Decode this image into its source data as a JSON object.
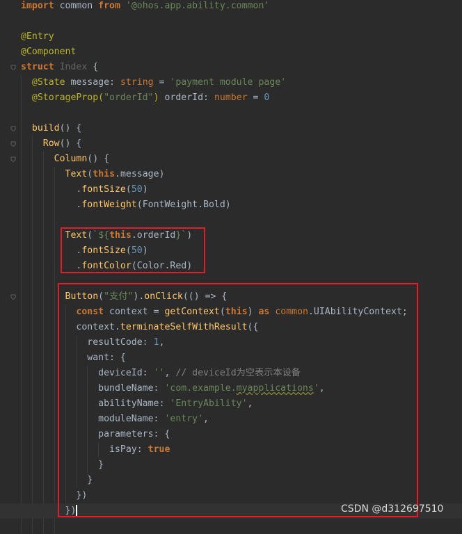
{
  "editor": {
    "lines": [
      {
        "segs": [
          {
            "c": "kw",
            "t": "import"
          },
          {
            "c": "",
            "t": " common "
          },
          {
            "c": "kw",
            "t": "from"
          },
          {
            "c": "",
            "t": " "
          },
          {
            "c": "str",
            "t": "'@ohos.app.ability.common'"
          }
        ]
      },
      {
        "segs": []
      },
      {
        "segs": [
          {
            "c": "ann",
            "t": "@Entry"
          }
        ]
      },
      {
        "segs": [
          {
            "c": "ann",
            "t": "@Component"
          }
        ]
      },
      {
        "segs": [
          {
            "c": "kw",
            "t": "struct"
          },
          {
            "c": "",
            "t": " "
          },
          {
            "c": "dim",
            "t": "Index"
          },
          {
            "c": "",
            "t": " {"
          }
        ]
      },
      {
        "segs": [
          {
            "c": "",
            "t": "  "
          },
          {
            "c": "ann",
            "t": "@State"
          },
          {
            "c": "",
            "t": " message: "
          },
          {
            "c": "kw2",
            "t": "string"
          },
          {
            "c": "",
            "t": " = "
          },
          {
            "c": "str",
            "t": "'payment module page'"
          }
        ]
      },
      {
        "segs": [
          {
            "c": "",
            "t": "  "
          },
          {
            "c": "ann",
            "t": "@StorageProp("
          },
          {
            "c": "str",
            "t": "\"orderId\""
          },
          {
            "c": "ann",
            "t": ")"
          },
          {
            "c": "",
            "t": " orderId: "
          },
          {
            "c": "kw2",
            "t": "number"
          },
          {
            "c": "",
            "t": " = "
          },
          {
            "c": "num",
            "t": "0"
          }
        ]
      },
      {
        "segs": []
      },
      {
        "segs": [
          {
            "c": "",
            "t": "  "
          },
          {
            "c": "fn",
            "t": "build"
          },
          {
            "c": "",
            "t": "() {"
          }
        ]
      },
      {
        "segs": [
          {
            "c": "",
            "t": "    "
          },
          {
            "c": "fn",
            "t": "Row"
          },
          {
            "c": "",
            "t": "() {"
          }
        ]
      },
      {
        "segs": [
          {
            "c": "",
            "t": "      "
          },
          {
            "c": "fn",
            "t": "Column"
          },
          {
            "c": "",
            "t": "() {"
          }
        ]
      },
      {
        "segs": [
          {
            "c": "",
            "t": "        "
          },
          {
            "c": "fn",
            "t": "Text"
          },
          {
            "c": "",
            "t": "("
          },
          {
            "c": "kw",
            "t": "this"
          },
          {
            "c": "",
            "t": ".message)"
          }
        ]
      },
      {
        "segs": [
          {
            "c": "",
            "t": "          ."
          },
          {
            "c": "fn",
            "t": "fontSize"
          },
          {
            "c": "",
            "t": "("
          },
          {
            "c": "num",
            "t": "50"
          },
          {
            "c": "",
            "t": ")"
          }
        ]
      },
      {
        "segs": [
          {
            "c": "",
            "t": "          ."
          },
          {
            "c": "fn",
            "t": "fontWeight"
          },
          {
            "c": "",
            "t": "(FontWeight.Bold)"
          }
        ]
      },
      {
        "segs": []
      },
      {
        "segs": [
          {
            "c": "",
            "t": "        "
          },
          {
            "c": "fn",
            "t": "Text"
          },
          {
            "c": "",
            "t": "("
          },
          {
            "c": "str",
            "t": "`${"
          },
          {
            "c": "kw",
            "t": "this"
          },
          {
            "c": "",
            "t": ".orderId"
          },
          {
            "c": "str",
            "t": "}`"
          },
          {
            "c": "",
            "t": ")"
          }
        ]
      },
      {
        "segs": [
          {
            "c": "",
            "t": "          ."
          },
          {
            "c": "fn",
            "t": "fontSize"
          },
          {
            "c": "",
            "t": "("
          },
          {
            "c": "num",
            "t": "50"
          },
          {
            "c": "",
            "t": ")"
          }
        ]
      },
      {
        "segs": [
          {
            "c": "",
            "t": "          ."
          },
          {
            "c": "fn",
            "t": "fontColor"
          },
          {
            "c": "",
            "t": "(Color.Red)"
          }
        ]
      },
      {
        "segs": []
      },
      {
        "segs": [
          {
            "c": "",
            "t": "        "
          },
          {
            "c": "fn",
            "t": "Button"
          },
          {
            "c": "",
            "t": "("
          },
          {
            "c": "str",
            "t": "\"支付\""
          },
          {
            "c": "",
            "t": ")."
          },
          {
            "c": "fn",
            "t": "onClick"
          },
          {
            "c": "",
            "t": "(() => {"
          }
        ]
      },
      {
        "segs": [
          {
            "c": "",
            "t": "          "
          },
          {
            "c": "kw",
            "t": "const"
          },
          {
            "c": "",
            "t": " context = "
          },
          {
            "c": "fn",
            "t": "getContext"
          },
          {
            "c": "",
            "t": "("
          },
          {
            "c": "kw",
            "t": "this"
          },
          {
            "c": "",
            "t": ") "
          },
          {
            "c": "kw",
            "t": "as"
          },
          {
            "c": "",
            "t": " "
          },
          {
            "c": "kw2",
            "t": "common"
          },
          {
            "c": "",
            "t": ".UIAbilityContext;"
          }
        ]
      },
      {
        "segs": [
          {
            "c": "",
            "t": "          context."
          },
          {
            "c": "fn",
            "t": "terminateSelfWithResult"
          },
          {
            "c": "",
            "t": "({"
          }
        ]
      },
      {
        "segs": [
          {
            "c": "",
            "t": "            resultCode: "
          },
          {
            "c": "num",
            "t": "1"
          },
          {
            "c": "",
            "t": ","
          }
        ]
      },
      {
        "segs": [
          {
            "c": "",
            "t": "            want: {"
          }
        ]
      },
      {
        "segs": [
          {
            "c": "",
            "t": "              deviceId: "
          },
          {
            "c": "str",
            "t": "''"
          },
          {
            "c": "",
            "t": ", "
          },
          {
            "c": "cmt",
            "t": "// deviceId为空表示本设备"
          }
        ]
      },
      {
        "segs": [
          {
            "c": "",
            "t": "              bundleName: "
          },
          {
            "c": "str",
            "t": "'com.example."
          },
          {
            "c": "str wavy",
            "t": "myapplications"
          },
          {
            "c": "str",
            "t": "'"
          },
          {
            "c": "",
            "t": ","
          }
        ]
      },
      {
        "segs": [
          {
            "c": "",
            "t": "              abilityName: "
          },
          {
            "c": "str",
            "t": "'EntryAbility'"
          },
          {
            "c": "",
            "t": ","
          }
        ]
      },
      {
        "segs": [
          {
            "c": "",
            "t": "              moduleName: "
          },
          {
            "c": "str",
            "t": "'entry'"
          },
          {
            "c": "",
            "t": ","
          }
        ]
      },
      {
        "segs": [
          {
            "c": "",
            "t": "              parameters: {"
          }
        ]
      },
      {
        "segs": [
          {
            "c": "",
            "t": "                isPay: "
          },
          {
            "c": "kw",
            "t": "true"
          }
        ]
      },
      {
        "segs": [
          {
            "c": "",
            "t": "              }"
          }
        ]
      },
      {
        "segs": [
          {
            "c": "",
            "t": "            }"
          }
        ]
      },
      {
        "segs": [
          {
            "c": "",
            "t": "          })"
          }
        ]
      },
      {
        "segs": [
          {
            "c": "",
            "t": "        })"
          }
        ]
      }
    ],
    "current_line": 33,
    "colors": {
      "background": "#2b2b2b",
      "keyword": "#cc7832",
      "string": "#6a8759",
      "number": "#6897bb",
      "annotation": "#bbb529",
      "function": "#ffc66d",
      "comment": "#808080",
      "highlight_box": "#e01e2a"
    }
  },
  "watermark": {
    "text": "CSDN @d312697510"
  }
}
